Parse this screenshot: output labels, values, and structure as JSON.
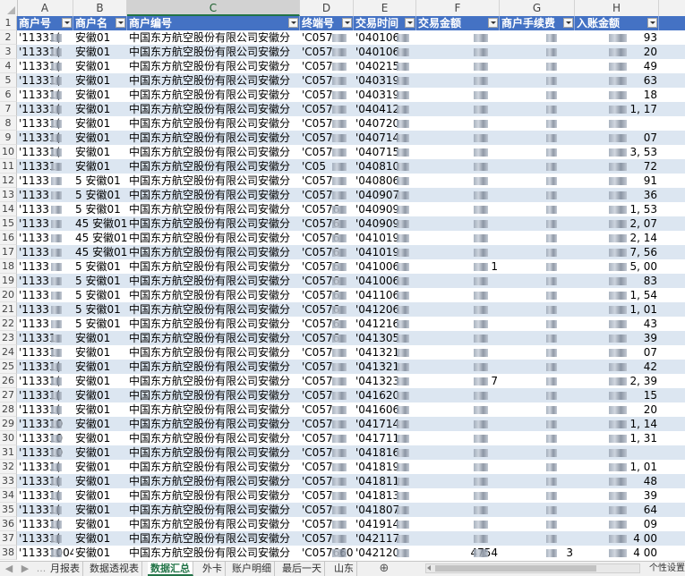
{
  "columns": [
    "A",
    "B",
    "C",
    "D",
    "E",
    "F",
    "G",
    "H"
  ],
  "selected_column": "C",
  "headers": [
    "商户号",
    "商户名",
    "商户编号",
    "终端号",
    "交易时间",
    "交易金额",
    "商户手续费",
    "入账金额"
  ],
  "rows": [
    {
      "n": "2",
      "a": "'11331(",
      "b": "安徽01",
      "c": "中国东方航空股份有限公司安徽分",
      "d": "'C057",
      "e": "'040106",
      "f": "",
      "g": "",
      "h": "93"
    },
    {
      "n": "3",
      "a": "'11331(",
      "b": "安徽01",
      "c": "中国东方航空股份有限公司安徽分",
      "d": "'C057",
      "e": "'040106",
      "f": "",
      "g": "",
      "h": "20"
    },
    {
      "n": "4",
      "a": "'11331(",
      "b": "安徽01",
      "c": "中国东方航空股份有限公司安徽分",
      "d": "'C057",
      "e": "'040215",
      "f": "",
      "g": "",
      "h": "49"
    },
    {
      "n": "5",
      "a": "'11331(",
      "b": "安徽01",
      "c": "中国东方航空股份有限公司安徽分",
      "d": "'C057",
      "e": "'040319",
      "f": "",
      "g": "",
      "h": "63"
    },
    {
      "n": "6",
      "a": "'11331(",
      "b": "安徽01",
      "c": "中国东方航空股份有限公司安徽分",
      "d": "'C057",
      "e": "'040319",
      "f": "",
      "g": "",
      "h": "18"
    },
    {
      "n": "7",
      "a": "'11331(",
      "b": "安徽01",
      "c": "中国东方航空股份有限公司安徽分",
      "d": "'C057",
      "e": "'040412",
      "f": "",
      "g": "",
      "h": "1,  17"
    },
    {
      "n": "8",
      "a": "'11331(",
      "b": "安徽01",
      "c": "中国东方航空股份有限公司安徽分",
      "d": "'C057",
      "e": "'040720",
      "f": "",
      "g": "",
      "h": ""
    },
    {
      "n": "9",
      "a": "'11331(",
      "b": "安徽01",
      "c": "中国东方航空股份有限公司安徽分",
      "d": "'C057",
      "e": "'040714",
      "f": "",
      "g": "",
      "h": "07"
    },
    {
      "n": "10",
      "a": "'11331(",
      "b": "安徽01",
      "c": "中国东方航空股份有限公司安徽分",
      "d": "'C057",
      "e": "'040715",
      "f": "",
      "g": "",
      "h": "3,  53"
    },
    {
      "n": "11",
      "a": "'11331",
      "b": "安徽01",
      "c": "中国东方航空股份有限公司安徽分",
      "d": "'C05",
      "e": "'040810",
      "f": "",
      "g": "",
      "h": "72"
    },
    {
      "n": "12",
      "a": "'1133",
      "b": "5 安徽01",
      "c": "中国东方航空股份有限公司安徽分",
      "d": "'C057",
      "e": "'040806",
      "f": "",
      "g": "",
      "h": "91"
    },
    {
      "n": "13",
      "a": "'1133",
      "b": "5 安徽01",
      "c": "中国东方航空股份有限公司安徽分",
      "d": "'C057",
      "e": "'040907",
      "f": "",
      "g": "",
      "h": "36"
    },
    {
      "n": "14",
      "a": "'1133",
      "b": "5 安徽01",
      "c": "中国东方航空股份有限公司安徽分",
      "d": "'C0576",
      "e": "'040909",
      "f": "",
      "g": "",
      "h": "1,  53"
    },
    {
      "n": "15",
      "a": "'1133",
      "b": "45 安徽01",
      "c": "中国东方航空股份有限公司安徽分",
      "d": "'C0576",
      "e": "'040909",
      "f": "",
      "g": "",
      "h": "2,  07"
    },
    {
      "n": "16",
      "a": "'1133",
      "b": "45 安徽01",
      "c": "中国东方航空股份有限公司安徽分",
      "d": "'C0576",
      "e": "'041019",
      "f": "",
      "g": "",
      "h": "2,  14"
    },
    {
      "n": "17",
      "a": "'1133",
      "b": "45 安徽01",
      "c": "中国东方航空股份有限公司安徽分",
      "d": "'C0576",
      "e": "'041019",
      "f": "",
      "g": "",
      "h": "7,  56"
    },
    {
      "n": "18",
      "a": "'1133",
      "b": "5 安徽01",
      "c": "中国东方航空股份有限公司安徽分",
      "d": "'C0576",
      "e": "'041006",
      "f": "1",
      "g": "",
      "h": "5,  00"
    },
    {
      "n": "19",
      "a": "'1133",
      "b": "5 安徽01",
      "c": "中国东方航空股份有限公司安徽分",
      "d": "'C0576",
      "e": "'041006",
      "f": "",
      "g": "",
      "h": "83"
    },
    {
      "n": "20",
      "a": "'1133",
      "b": "5 安徽01",
      "c": "中国东方航空股份有限公司安徽分",
      "d": "'C0576",
      "e": "'041106",
      "f": "",
      "g": "",
      "h": "1,  54"
    },
    {
      "n": "21",
      "a": "'1133",
      "b": "5 安徽01",
      "c": "中国东方航空股份有限公司安徽分",
      "d": "'C0576",
      "e": "'041206",
      "f": "",
      "g": "",
      "h": "1,  01"
    },
    {
      "n": "22",
      "a": "'1133",
      "b": "5 安徽01",
      "c": "中国东方航空股份有限公司安徽分",
      "d": "'C0576",
      "e": "'041216",
      "f": "",
      "g": "",
      "h": "43"
    },
    {
      "n": "23",
      "a": "'11331",
      "b": "安徽01",
      "c": "中国东方航空股份有限公司安徽分",
      "d": "'C0576",
      "e": "'041305",
      "f": "",
      "g": "",
      "h": "39"
    },
    {
      "n": "24",
      "a": "'11331",
      "b": "安徽01",
      "c": "中国东方航空股份有限公司安徽分",
      "d": "'C057",
      "e": "'041321",
      "f": "",
      "g": "",
      "h": "07"
    },
    {
      "n": "25",
      "a": "'11331(",
      "b": "安徽01",
      "c": "中国东方航空股份有限公司安徽分",
      "d": "'C057",
      "e": "'041321",
      "f": "",
      "g": "",
      "h": "42"
    },
    {
      "n": "26",
      "a": "'11331(",
      "b": "安徽01",
      "c": "中国东方航空股份有限公司安徽分",
      "d": "'C057",
      "e": "'041323",
      "f": "7",
      "g": "",
      "h": "2,  39"
    },
    {
      "n": "27",
      "a": "'11331(",
      "b": "安徽01",
      "c": "中国东方航空股份有限公司安徽分",
      "d": "'C057",
      "e": "'041620",
      "f": "",
      "g": "",
      "h": "15"
    },
    {
      "n": "28",
      "a": "'11331(",
      "b": "安徽01",
      "c": "中国东方航空股份有限公司安徽分",
      "d": "'C057",
      "e": "'041606",
      "f": "",
      "g": "",
      "h": "20"
    },
    {
      "n": "29",
      "a": "'113310",
      "b": "安徽01",
      "c": "中国东方航空股份有限公司安徽分",
      "d": "'C057",
      "e": "'041714",
      "f": "",
      "g": "",
      "h": "1,  14"
    },
    {
      "n": "30",
      "a": "'113310",
      "b": "安徽01",
      "c": "中国东方航空股份有限公司安徽分",
      "d": "'C057",
      "e": "'041711",
      "f": "",
      "g": "",
      "h": "1,  31"
    },
    {
      "n": "31",
      "a": "'113310",
      "b": "安徽01",
      "c": "中国东方航空股份有限公司安徽分",
      "d": "'C057",
      "e": "'041816",
      "f": "",
      "g": "",
      "h": ""
    },
    {
      "n": "32",
      "a": "'11331(",
      "b": "安徽01",
      "c": "中国东方航空股份有限公司安徽分",
      "d": "'C057",
      "e": "'041819",
      "f": "",
      "g": "",
      "h": "1,  01"
    },
    {
      "n": "33",
      "a": "'11331(",
      "b": "安徽01",
      "c": "中国东方航空股份有限公司安徽分",
      "d": "'C057",
      "e": "'041811",
      "f": "",
      "g": "",
      "h": "48"
    },
    {
      "n": "34",
      "a": "'11331(",
      "b": "安徽01",
      "c": "中国东方航空股份有限公司安徽分",
      "d": "'C057",
      "e": "'041813",
      "f": "",
      "g": "",
      "h": "39"
    },
    {
      "n": "35",
      "a": "'11331(",
      "b": "安徽01",
      "c": "中国东方航空股份有限公司安徽分",
      "d": "'C057",
      "e": "'041807",
      "f": "",
      "g": "",
      "h": "64"
    },
    {
      "n": "36",
      "a": "'11331(",
      "b": "安徽01",
      "c": "中国东方航空股份有限公司安徽分",
      "d": "'C057",
      "e": "'041914",
      "f": "",
      "g": "",
      "h": "09"
    },
    {
      "n": "37",
      "a": "'11331(",
      "b": "安徽01",
      "c": "中国东方航空股份有限公司安徽分",
      "d": "'C057",
      "e": "'042117",
      "f": "",
      "g": "",
      "h": "4  00"
    },
    {
      "n": "38",
      "a": "'113310045",
      "b": "安徽01",
      "c": "中国东方航空股份有限公司安徽分",
      "d": "'C0576602",
      "e": "'042120",
      "f": "4754",
      "g": "3",
      "h": "4  00"
    }
  ],
  "sheet_tabs": [
    "月报表",
    "数据透视表",
    "数据汇总",
    "外卡",
    "账户明细",
    "最后一天",
    "山东"
  ],
  "active_tab": "数据汇总",
  "add_sheet": "⊕",
  "nav_more": "...",
  "status_right": "个性设置"
}
